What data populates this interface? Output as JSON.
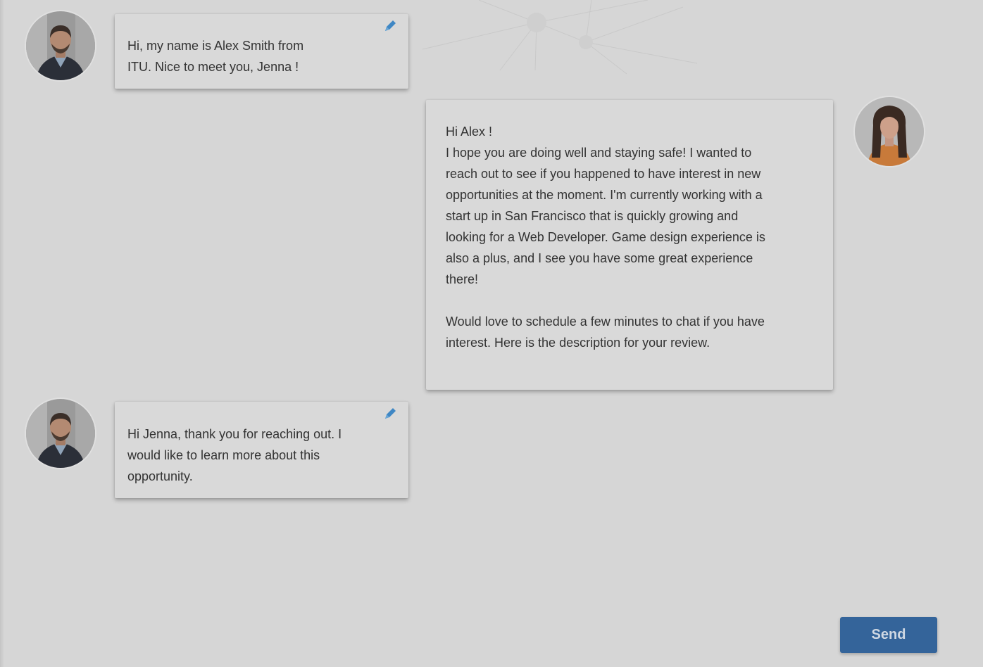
{
  "messages": [
    {
      "sender": "alex",
      "text": "Hi, my name is Alex Smith from\nITU. Nice to meet you, Jenna !",
      "editable": true
    },
    {
      "sender": "jenna",
      "text": "Hi Alex !\nI hope you are doing well and staying safe! I wanted to\nreach out to see if you happened to have interest in new\nopportunities at the moment. I'm currently working with a\nstart up in San Francisco that is quickly growing and\nlooking for a Web Developer. Game design experience is\nalso a plus, and I see you have some great experience\nthere!\n\nWould love to schedule a few minutes to chat if you have\ninterest. Here is the description for your review.",
      "editable": false
    },
    {
      "sender": "alex",
      "text": "Hi Jenna, thank you for reaching out. I\nwould like to learn more about this\nopportunity.",
      "editable": true
    }
  ],
  "composer": {
    "send_label": "Send"
  },
  "colors": {
    "background": "#d6d6d6",
    "bubble": "#d9d9d9",
    "send_button": "#34649a",
    "edit_icon": "#3f87c4"
  },
  "icons": {
    "edit": "pencil-icon"
  }
}
